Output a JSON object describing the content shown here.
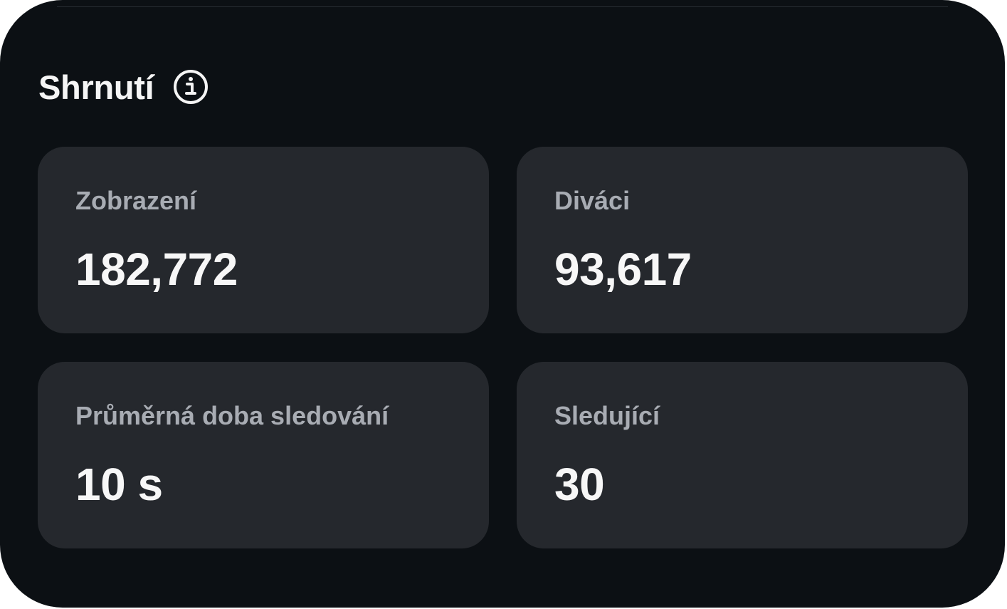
{
  "summary": {
    "title": "Shrnutí",
    "info_icon": "info-circle-icon"
  },
  "stats": [
    {
      "label": "Zobrazení",
      "value": "182,772"
    },
    {
      "label": "Diváci",
      "value": "93,617"
    },
    {
      "label": "Průměrná doba sledování",
      "value": "10 s"
    },
    {
      "label": "Sledující",
      "value": "30"
    }
  ],
  "colors": {
    "background": "#0c1014",
    "card": "#25282d",
    "label": "#a8acb3",
    "value": "#f7f7f7"
  }
}
